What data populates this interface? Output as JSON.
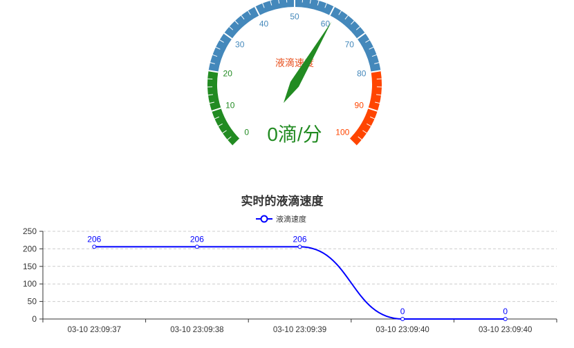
{
  "gauge": {
    "title": "液滴速度",
    "value": 0,
    "value_text": "0滴/分",
    "min": 0,
    "max": 100,
    "tick_labels": [
      "0",
      "10",
      "20",
      "30",
      "40",
      "50",
      "60",
      "70",
      "80",
      "90",
      "100"
    ],
    "bands": [
      {
        "to": 0.2,
        "color": "#228b22"
      },
      {
        "to": 0.8,
        "color": "#4488bb"
      },
      {
        "to": 1.0,
        "color": "#ff4500"
      }
    ],
    "pointer_color": "#228b22",
    "title_color": "#e8501e",
    "value_color": "#228b22"
  },
  "chart_data": {
    "type": "line",
    "title": "实时的液滴速度",
    "legend": "top-center",
    "categories": [
      "03-10 23:09:37",
      "03-10 23:09:38",
      "03-10 23:09:39",
      "03-10 23:09:40",
      "03-10 23:09:40"
    ],
    "series": [
      {
        "name": "液滴速度",
        "values": [
          206,
          206,
          206,
          0,
          0
        ],
        "color": "#0000ff",
        "smooth": true
      }
    ],
    "data_labels": [
      "206",
      "206",
      "206",
      "0",
      "0"
    ],
    "y_ticks": [
      "0",
      "50",
      "100",
      "150",
      "200",
      "250"
    ],
    "ylim": [
      0,
      250
    ],
    "grid": true
  }
}
